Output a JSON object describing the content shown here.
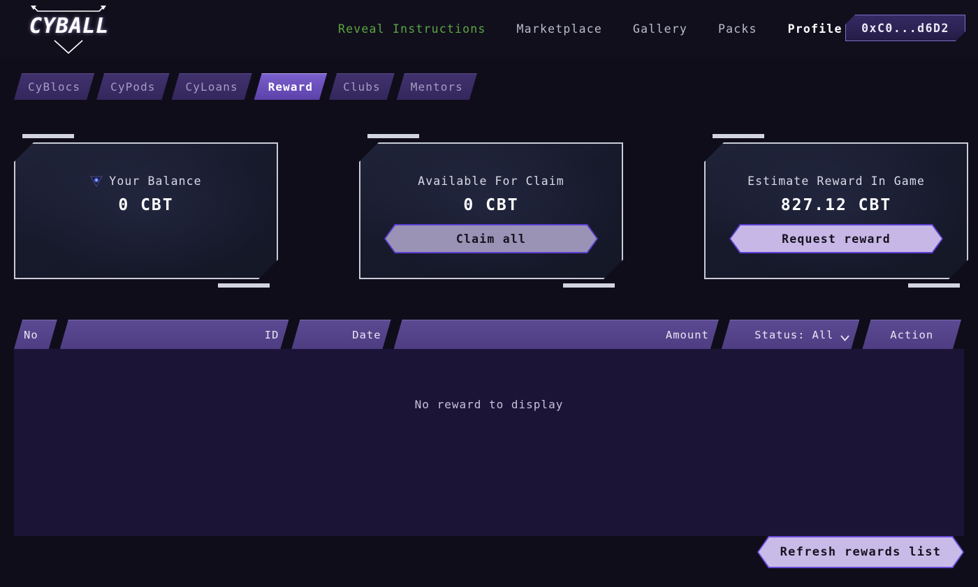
{
  "header": {
    "logo": "CYBALL",
    "nav": [
      {
        "label": "Reveal Instructions",
        "style": "accent"
      },
      {
        "label": "Marketplace",
        "style": "normal"
      },
      {
        "label": "Gallery",
        "style": "normal"
      },
      {
        "label": "Packs",
        "style": "normal"
      },
      {
        "label": "Profile",
        "style": "current"
      }
    ],
    "wallet": "0xC0...d6D2"
  },
  "tabs": [
    {
      "label": "CyBlocs",
      "active": false
    },
    {
      "label": "CyPods",
      "active": false
    },
    {
      "label": "CyLoans",
      "active": false
    },
    {
      "label": "Reward",
      "active": true
    },
    {
      "label": "Clubs",
      "active": false
    },
    {
      "label": "Mentors",
      "active": false
    }
  ],
  "cards": [
    {
      "title": "Your Balance",
      "value": "0 CBT",
      "icon": "cbt-token-icon",
      "button": null
    },
    {
      "title": "Available For Claim",
      "value": "0 CBT",
      "icon": null,
      "button": {
        "label": "Claim all",
        "state": "disabled"
      }
    },
    {
      "title": "Estimate Reward In Game",
      "value": "827.12 CBT",
      "icon": null,
      "button": {
        "label": "Request reward",
        "state": "primary"
      }
    }
  ],
  "table": {
    "columns": [
      {
        "key": "no",
        "label": "No"
      },
      {
        "key": "id",
        "label": "ID"
      },
      {
        "key": "date",
        "label": "Date"
      },
      {
        "key": "amount",
        "label": "Amount"
      },
      {
        "key": "status",
        "label": "Status:",
        "value": "All"
      },
      {
        "key": "action",
        "label": "Action"
      }
    ],
    "rows": [],
    "empty_message": "No reward to display"
  },
  "footer": {
    "refresh_label": "Refresh rewards list"
  },
  "colors": {
    "page_bg": "#100d1a",
    "accent_green": "#5aa83f",
    "tab_active": "#7a5fcd",
    "table_header": "#5b4a93",
    "table_body": "#1b1437",
    "button_primary": "#c6b7e6",
    "button_disabled": "#9b93b5",
    "button_border": "#6b4ddb",
    "card_border": "#c9ccd8"
  }
}
